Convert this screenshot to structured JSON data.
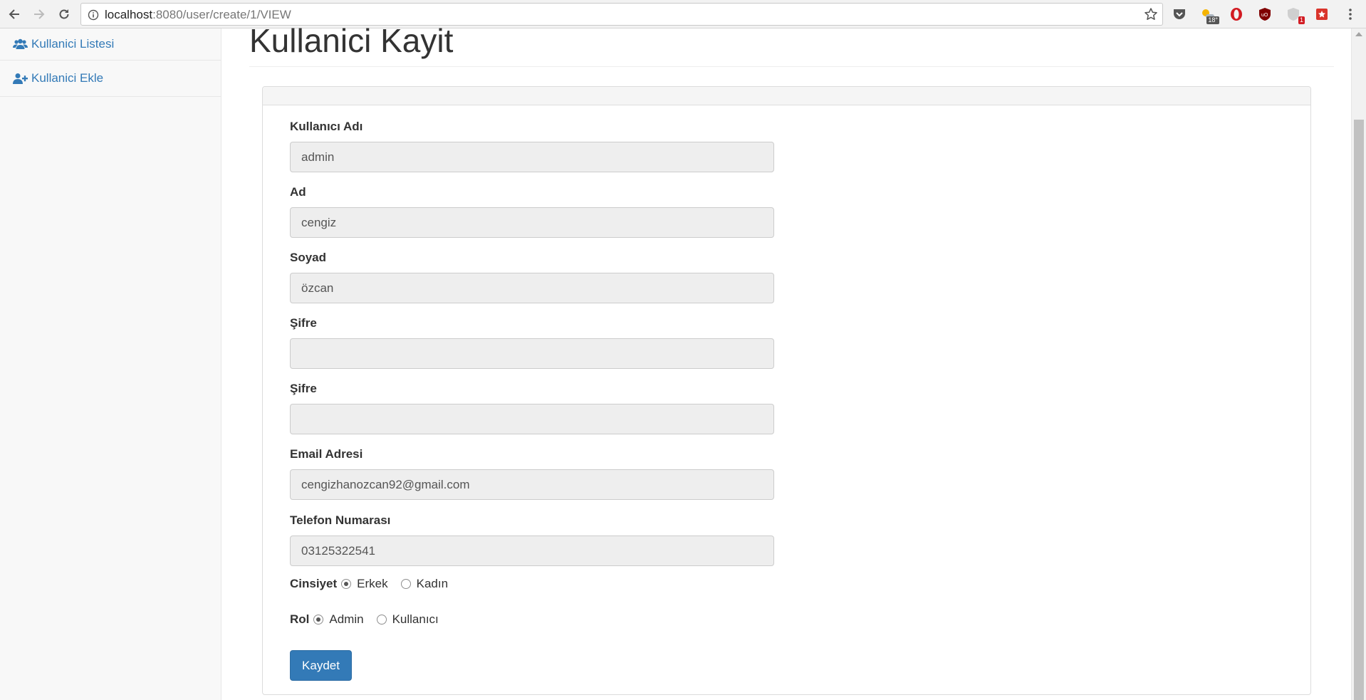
{
  "browser": {
    "url_host": "localhost",
    "url_rest": ":8080/user/create/1/VIEW",
    "weather_badge": "18°",
    "notif_badge": "1"
  },
  "sidebar": {
    "items": [
      {
        "label": "Kullanici Listesi",
        "icon": "users-icon"
      },
      {
        "label": "Kullanici Ekle",
        "icon": "user-plus-icon"
      }
    ]
  },
  "page": {
    "title": "Kullanici Kayit"
  },
  "form": {
    "username": {
      "label": "Kullanıcı Adı",
      "value": "admin"
    },
    "first_name": {
      "label": "Ad",
      "value": "cengiz"
    },
    "last_name": {
      "label": "Soyad",
      "value": "özcan"
    },
    "password": {
      "label": "Şifre",
      "value": ""
    },
    "password_confirm": {
      "label": "Şifre",
      "value": ""
    },
    "email": {
      "label": "Email Adresi",
      "value": "cengizhanozcan92@gmail.com"
    },
    "phone": {
      "label": "Telefon Numarası",
      "value": "03125322541"
    },
    "gender": {
      "label": "Cinsiyet",
      "options": [
        "Erkek",
        "Kadın"
      ],
      "selected": "Erkek"
    },
    "role": {
      "label": "Rol",
      "options": [
        "Admin",
        "Kullanıcı"
      ],
      "selected": "Admin"
    },
    "submit_label": "Kaydet"
  },
  "colors": {
    "link": "#337ab7",
    "primary_button": "#337ab7",
    "input_disabled_bg": "#eeeeee"
  }
}
